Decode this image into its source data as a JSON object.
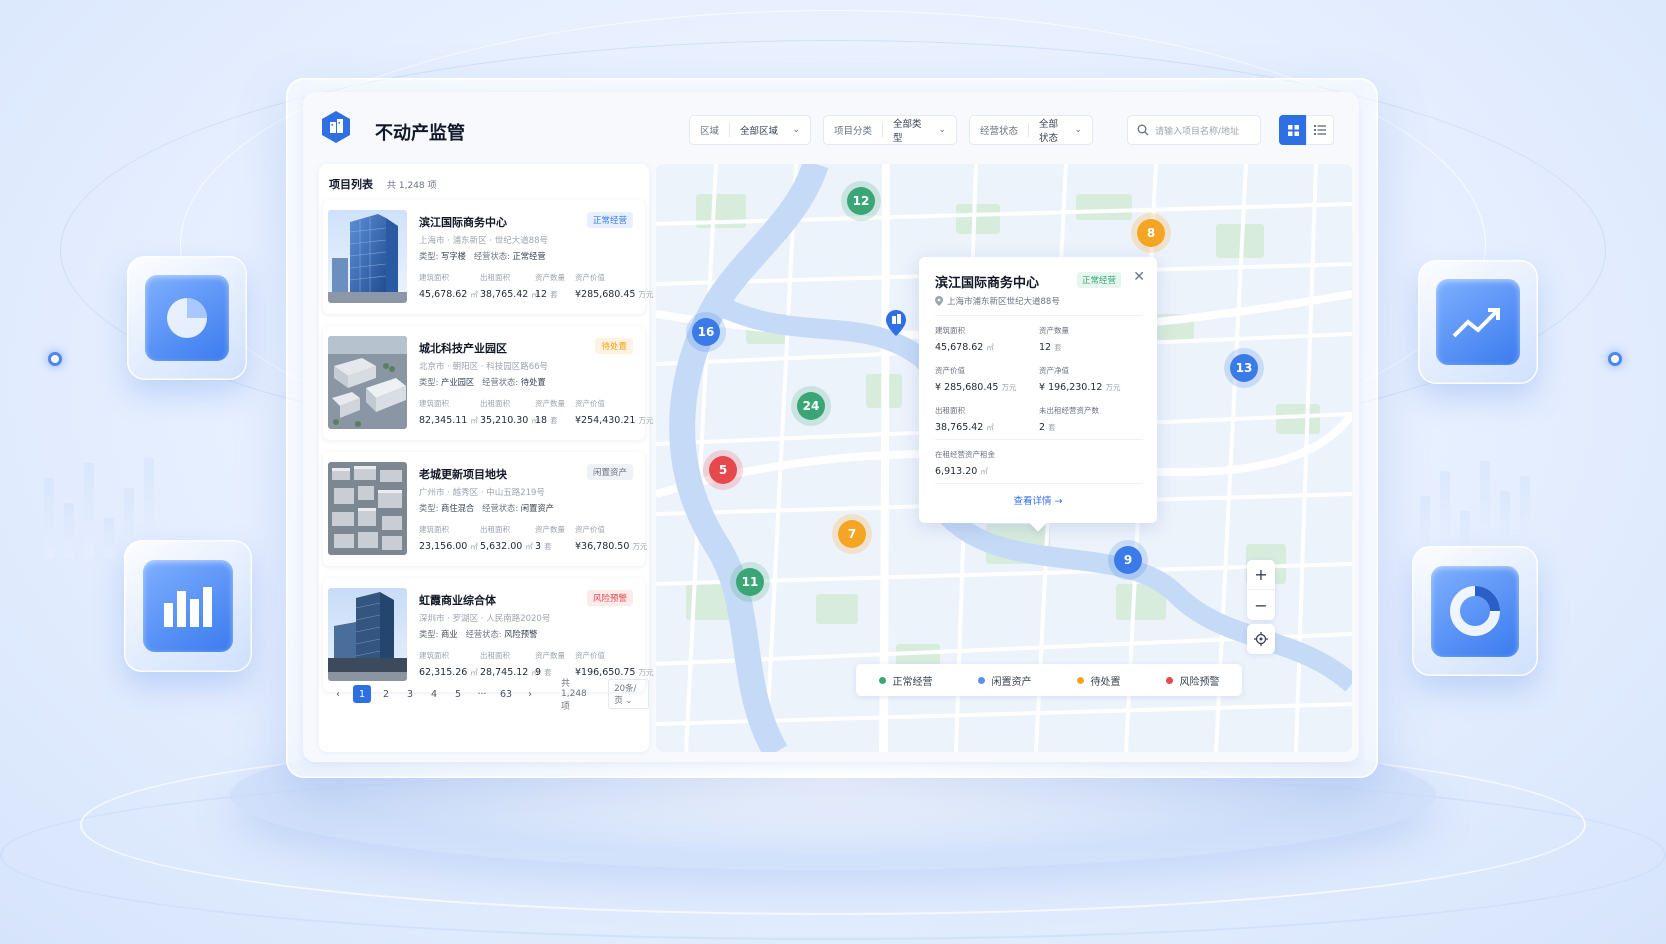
{
  "app": {
    "title": "不动产监管"
  },
  "filters": [
    {
      "label": "区域",
      "value": "全部区域"
    },
    {
      "label": "项目分类",
      "value": "全部类型"
    },
    {
      "label": "经营状态",
      "value": "全部状态"
    }
  ],
  "search": {
    "placeholder": "请输入项目名称/地址"
  },
  "list": {
    "title": "项目列表",
    "count": "共 1,248 项",
    "metric_labels": [
      "建筑面积",
      "出租面积",
      "资产数量",
      "资产价值"
    ],
    "type_label": "类型:",
    "status_label": "经营状态:",
    "items": [
      {
        "name": "滨江国际商务中心",
        "status": "正常经营",
        "address": "上海市 · 浦东新区 · 世纪大道88号",
        "type": "写字楼",
        "op_status": "正常经营",
        "area": "45,678.62",
        "area_unit": "㎡",
        "leased": "38,765.42",
        "leased_unit": "㎡",
        "assets": "12",
        "assets_unit": "套",
        "value": "¥285,680.45",
        "value_unit": "万元"
      },
      {
        "name": "城北科技产业园区",
        "status": "待处置",
        "address": "北京市 · 朝阳区 · 科技园区路66号",
        "type": "产业园区",
        "op_status": "待处置",
        "area": "82,345.11",
        "area_unit": "㎡",
        "leased": "35,210.30",
        "leased_unit": "㎡",
        "assets": "18",
        "assets_unit": "套",
        "value": "¥254,430.21",
        "value_unit": "万元"
      },
      {
        "name": "老城更新项目地块",
        "status": "闲置资产",
        "address": "广州市 · 越秀区 · 中山五路219号",
        "type": "商住混合",
        "op_status": "闲置资产",
        "area": "23,156.00",
        "area_unit": "㎡",
        "leased": "5,632.00",
        "leased_unit": "㎡",
        "assets": "3",
        "assets_unit": "套",
        "value": "¥36,780.50",
        "value_unit": "万元"
      },
      {
        "name": "虹霞商业综合体",
        "status": "风险预警",
        "address": "深圳市 · 罗湖区 · 人民南路2020号",
        "type": "商业",
        "op_status": "风险预警",
        "area": "62,315.26",
        "area_unit": "㎡",
        "leased": "28,745.12",
        "leased_unit": "㎡",
        "assets": "9",
        "assets_unit": "套",
        "value": "¥196,650.75",
        "value_unit": "万元"
      }
    ]
  },
  "pagination": {
    "prev": "‹",
    "next": "›",
    "pages": [
      "1",
      "2",
      "3",
      "4",
      "5",
      "···",
      "63"
    ],
    "current": "1",
    "total": "共 1,248 项",
    "page_size": "20条/页 ⌄"
  },
  "map": {
    "clusters": [
      {
        "count": "12",
        "status": "normal"
      },
      {
        "count": "8",
        "status": "pending"
      },
      {
        "count": "16",
        "status": "idle"
      },
      {
        "count": "13",
        "status": "idle"
      },
      {
        "count": "24",
        "status": "normal"
      },
      {
        "count": "5",
        "status": "risk"
      },
      {
        "count": "7",
        "status": "pending"
      },
      {
        "count": "9",
        "status": "idle"
      },
      {
        "count": "11",
        "status": "normal"
      }
    ],
    "popup": {
      "title": "滨江国际商务中心",
      "badge": "正常经营",
      "address": "上海市浦东新区世纪大道88号",
      "fields": [
        {
          "label": "建筑面积",
          "value": "45,678.62",
          "unit": "㎡"
        },
        {
          "label": "资产数量",
          "value": "12",
          "unit": "套"
        },
        {
          "label": "资产价值",
          "value": "¥ 285,680.45",
          "unit": "万元"
        },
        {
          "label": "资产净值",
          "value": "¥ 196,230.12",
          "unit": "万元"
        },
        {
          "label": "出租面积",
          "value": "38,765.42",
          "unit": "㎡"
        },
        {
          "label": "未出租经营资产数",
          "value": "2",
          "unit": "套"
        },
        {
          "label": "在租经营资产租金",
          "value": "6,913.20",
          "unit": "㎡"
        }
      ],
      "link": "查看详情 →"
    },
    "controls": {
      "zoom_in": "+",
      "zoom_out": "−"
    },
    "legend": [
      {
        "label": "正常经营",
        "color": "#3aa676"
      },
      {
        "label": "闲置资产",
        "color": "#5b8ff0"
      },
      {
        "label": "待处置",
        "color": "#f5a524"
      },
      {
        "label": "风险预警",
        "color": "#e5484d"
      }
    ]
  },
  "colors": {
    "primary": "#2f6fe4",
    "normal": "#3aa676",
    "idle": "#3a7be8",
    "pending": "#f5a524",
    "risk": "#e5484d"
  }
}
